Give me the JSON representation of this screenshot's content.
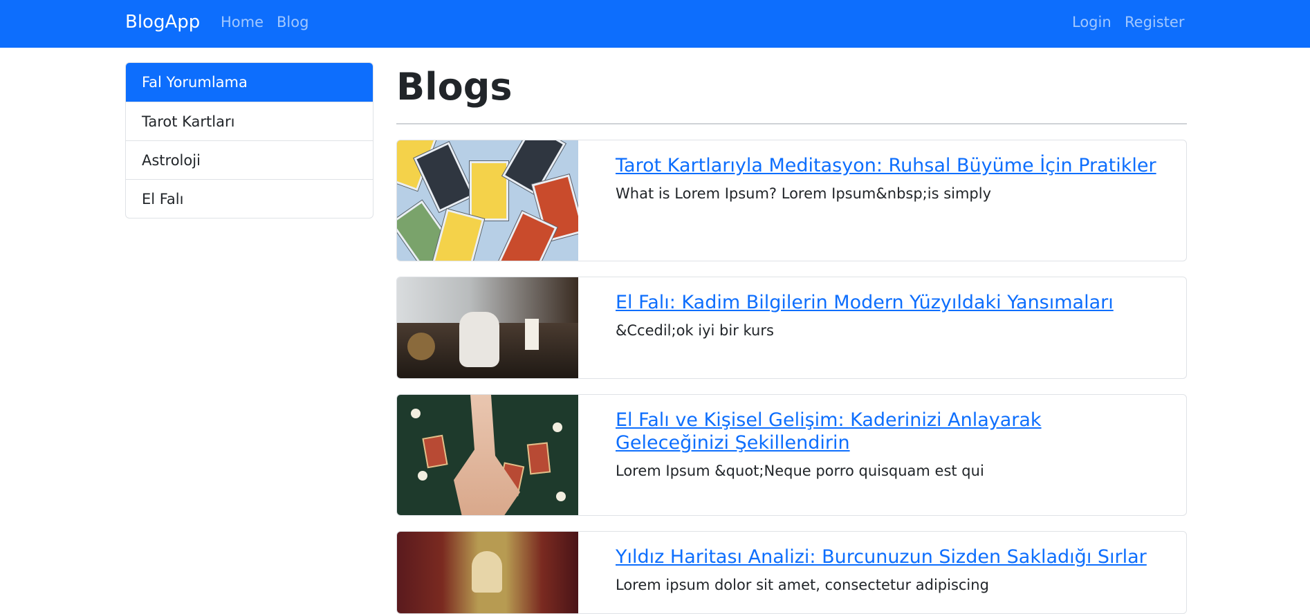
{
  "navbar": {
    "brand": "BlogApp",
    "links": [
      {
        "label": "Home"
      },
      {
        "label": "Blog"
      }
    ],
    "auth": [
      {
        "label": "Login"
      },
      {
        "label": "Register"
      }
    ],
    "background_color": "#0d6efd"
  },
  "sidebar": {
    "items": [
      {
        "label": "Fal Yorumlama",
        "active": true
      },
      {
        "label": "Tarot Kartları",
        "active": false
      },
      {
        "label": "Astroloji",
        "active": false
      },
      {
        "label": "El Falı",
        "active": false
      }
    ],
    "active_color": "#0d6efd"
  },
  "main": {
    "title": "Blogs",
    "posts": [
      {
        "title": "Tarot Kartlarıyla Meditasyon: Ruhsal Büyüme İçin Pratikler",
        "excerpt": "What is Lorem Ipsum? Lorem Ipsum&nbsp;is simply",
        "image": "tarot-cards-image"
      },
      {
        "title": "El Falı: Kadim Bilgilerin Modern Yüzyıldaki Yansımaları",
        "excerpt": "&Ccedil;ok iyi bir kurs",
        "image": "palm-reading-table-image"
      },
      {
        "title": "El Falı ve Kişisel Gelişim: Kaderinizi Anlayarak Geleceğinizi Şekillendirin",
        "excerpt": "Lorem Ipsum &quot;Neque porro quisquam est qui",
        "image": "palm-reading-hands-image"
      },
      {
        "title": "Yıldız Haritası Analizi: Burcunuzun Sizden Sakladığı Sırlar",
        "excerpt": "Lorem ipsum dolor sit amet, consectetur adipiscing",
        "image": "fortune-teller-image"
      }
    ],
    "link_color": "#0d6efd"
  }
}
